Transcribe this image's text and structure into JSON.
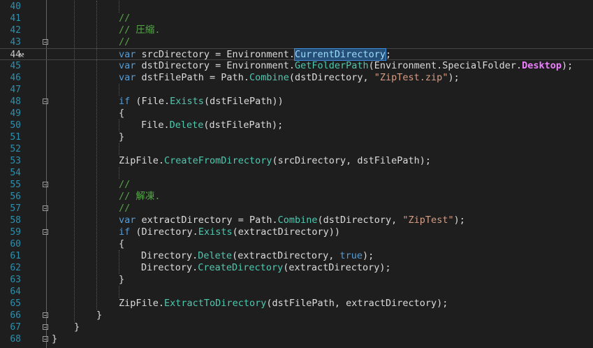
{
  "theme": {
    "background": "#1e1e1e",
    "line_number_color": "#2b91af",
    "keyword_color": "#569cd6",
    "string_color": "#d69d85",
    "comment_color": "#57a64a",
    "method_color": "#4ec9b0",
    "property_color": "#9cdcfe",
    "enum_value_color": "#ee7fff",
    "selection_color": "#264f78"
  },
  "editor": {
    "current_line_number": "44",
    "current_line_glyph": "hammer-icon",
    "lines": [
      {
        "num": "40",
        "indent": 0,
        "fold": false,
        "tokens": []
      },
      {
        "num": "41",
        "indent": 3,
        "fold": false,
        "tokens": [
          {
            "t": "//",
            "k": "cmt"
          }
        ]
      },
      {
        "num": "42",
        "indent": 3,
        "fold": false,
        "tokens": [
          {
            "t": "// 圧縮.",
            "k": "cmt"
          }
        ]
      },
      {
        "num": "43",
        "indent": 3,
        "fold": true,
        "tokens": [
          {
            "t": "//",
            "k": "cmt"
          }
        ]
      },
      {
        "num": "44",
        "indent": 3,
        "fold": false,
        "current": true,
        "tokens": [
          {
            "t": "var",
            "k": "kw"
          },
          {
            "t": " srcDirectory = Environment.",
            "k": "plain"
          },
          {
            "t": "CurrentDirectory",
            "k": "hl"
          },
          {
            "t": ";",
            "k": "plain"
          }
        ]
      },
      {
        "num": "45",
        "indent": 3,
        "fold": false,
        "tokens": [
          {
            "t": "var",
            "k": "kw"
          },
          {
            "t": " dstDirectory = Environment.",
            "k": "plain"
          },
          {
            "t": "GetFolderPath",
            "k": "method"
          },
          {
            "t": "(Environment.SpecialFolder.",
            "k": "plain"
          },
          {
            "t": "Desktop",
            "k": "enumval"
          },
          {
            "t": ");",
            "k": "plain"
          }
        ]
      },
      {
        "num": "46",
        "indent": 3,
        "fold": false,
        "tokens": [
          {
            "t": "var",
            "k": "kw"
          },
          {
            "t": " dstFilePath = Path.",
            "k": "plain"
          },
          {
            "t": "Combine",
            "k": "method"
          },
          {
            "t": "(dstDirectory, ",
            "k": "plain"
          },
          {
            "t": "\"ZipTest.zip\"",
            "k": "str"
          },
          {
            "t": ");",
            "k": "plain"
          }
        ]
      },
      {
        "num": "47",
        "indent": 0,
        "fold": false,
        "tokens": []
      },
      {
        "num": "48",
        "indent": 3,
        "fold": true,
        "tokens": [
          {
            "t": "if",
            "k": "kw"
          },
          {
            "t": " (File.",
            "k": "plain"
          },
          {
            "t": "Exists",
            "k": "method"
          },
          {
            "t": "(dstFilePath))",
            "k": "plain"
          }
        ]
      },
      {
        "num": "49",
        "indent": 3,
        "fold": false,
        "tokens": [
          {
            "t": "{",
            "k": "plain"
          }
        ]
      },
      {
        "num": "50",
        "indent": 4,
        "fold": false,
        "tokens": [
          {
            "t": "File.",
            "k": "plain"
          },
          {
            "t": "Delete",
            "k": "method"
          },
          {
            "t": "(dstFilePath);",
            "k": "plain"
          }
        ]
      },
      {
        "num": "51",
        "indent": 3,
        "fold": false,
        "tokens": [
          {
            "t": "}",
            "k": "plain"
          }
        ]
      },
      {
        "num": "52",
        "indent": 0,
        "fold": false,
        "tokens": []
      },
      {
        "num": "53",
        "indent": 3,
        "fold": false,
        "tokens": [
          {
            "t": "ZipFile.",
            "k": "plain"
          },
          {
            "t": "CreateFromDirectory",
            "k": "method"
          },
          {
            "t": "(srcDirectory, dstFilePath);",
            "k": "plain"
          }
        ]
      },
      {
        "num": "54",
        "indent": 0,
        "fold": false,
        "tokens": []
      },
      {
        "num": "55",
        "indent": 3,
        "fold": true,
        "tokens": [
          {
            "t": "//",
            "k": "cmt"
          }
        ]
      },
      {
        "num": "56",
        "indent": 3,
        "fold": false,
        "tokens": [
          {
            "t": "// 解凍.",
            "k": "cmt"
          }
        ]
      },
      {
        "num": "57",
        "indent": 3,
        "fold": true,
        "tokens": [
          {
            "t": "//",
            "k": "cmt"
          }
        ]
      },
      {
        "num": "58",
        "indent": 3,
        "fold": false,
        "tokens": [
          {
            "t": "var",
            "k": "kw"
          },
          {
            "t": " extractDirectory = Path.",
            "k": "plain"
          },
          {
            "t": "Combine",
            "k": "method"
          },
          {
            "t": "(dstDirectory, ",
            "k": "plain"
          },
          {
            "t": "\"ZipTest\"",
            "k": "str"
          },
          {
            "t": ");",
            "k": "plain"
          }
        ]
      },
      {
        "num": "59",
        "indent": 3,
        "fold": true,
        "tokens": [
          {
            "t": "if",
            "k": "kw"
          },
          {
            "t": " (Directory.",
            "k": "plain"
          },
          {
            "t": "Exists",
            "k": "method"
          },
          {
            "t": "(extractDirectory))",
            "k": "plain"
          }
        ]
      },
      {
        "num": "60",
        "indent": 3,
        "fold": false,
        "tokens": [
          {
            "t": "{",
            "k": "plain"
          }
        ]
      },
      {
        "num": "61",
        "indent": 4,
        "fold": false,
        "tokens": [
          {
            "t": "Directory.",
            "k": "plain"
          },
          {
            "t": "Delete",
            "k": "method"
          },
          {
            "t": "(extractDirectory, ",
            "k": "plain"
          },
          {
            "t": "true",
            "k": "kw"
          },
          {
            "t": ");",
            "k": "plain"
          }
        ]
      },
      {
        "num": "62",
        "indent": 4,
        "fold": false,
        "tokens": [
          {
            "t": "Directory.",
            "k": "plain"
          },
          {
            "t": "CreateDirectory",
            "k": "method"
          },
          {
            "t": "(extractDirectory);",
            "k": "plain"
          }
        ]
      },
      {
        "num": "63",
        "indent": 3,
        "fold": false,
        "tokens": [
          {
            "t": "}",
            "k": "plain"
          }
        ]
      },
      {
        "num": "64",
        "indent": 0,
        "fold": false,
        "tokens": []
      },
      {
        "num": "65",
        "indent": 3,
        "fold": false,
        "tokens": [
          {
            "t": "ZipFile.",
            "k": "plain"
          },
          {
            "t": "ExtractToDirectory",
            "k": "method"
          },
          {
            "t": "(dstFilePath, extractDirectory);",
            "k": "plain"
          }
        ]
      },
      {
        "num": "66",
        "indent": 2,
        "fold": true,
        "tokens": [
          {
            "t": "}",
            "k": "plain"
          }
        ]
      },
      {
        "num": "67",
        "indent": 1,
        "fold": true,
        "tokens": [
          {
            "t": "}",
            "k": "plain"
          }
        ]
      },
      {
        "num": "68",
        "indent": 0,
        "fold": true,
        "tokens": [
          {
            "t": "}",
            "k": "plain"
          }
        ]
      }
    ]
  }
}
